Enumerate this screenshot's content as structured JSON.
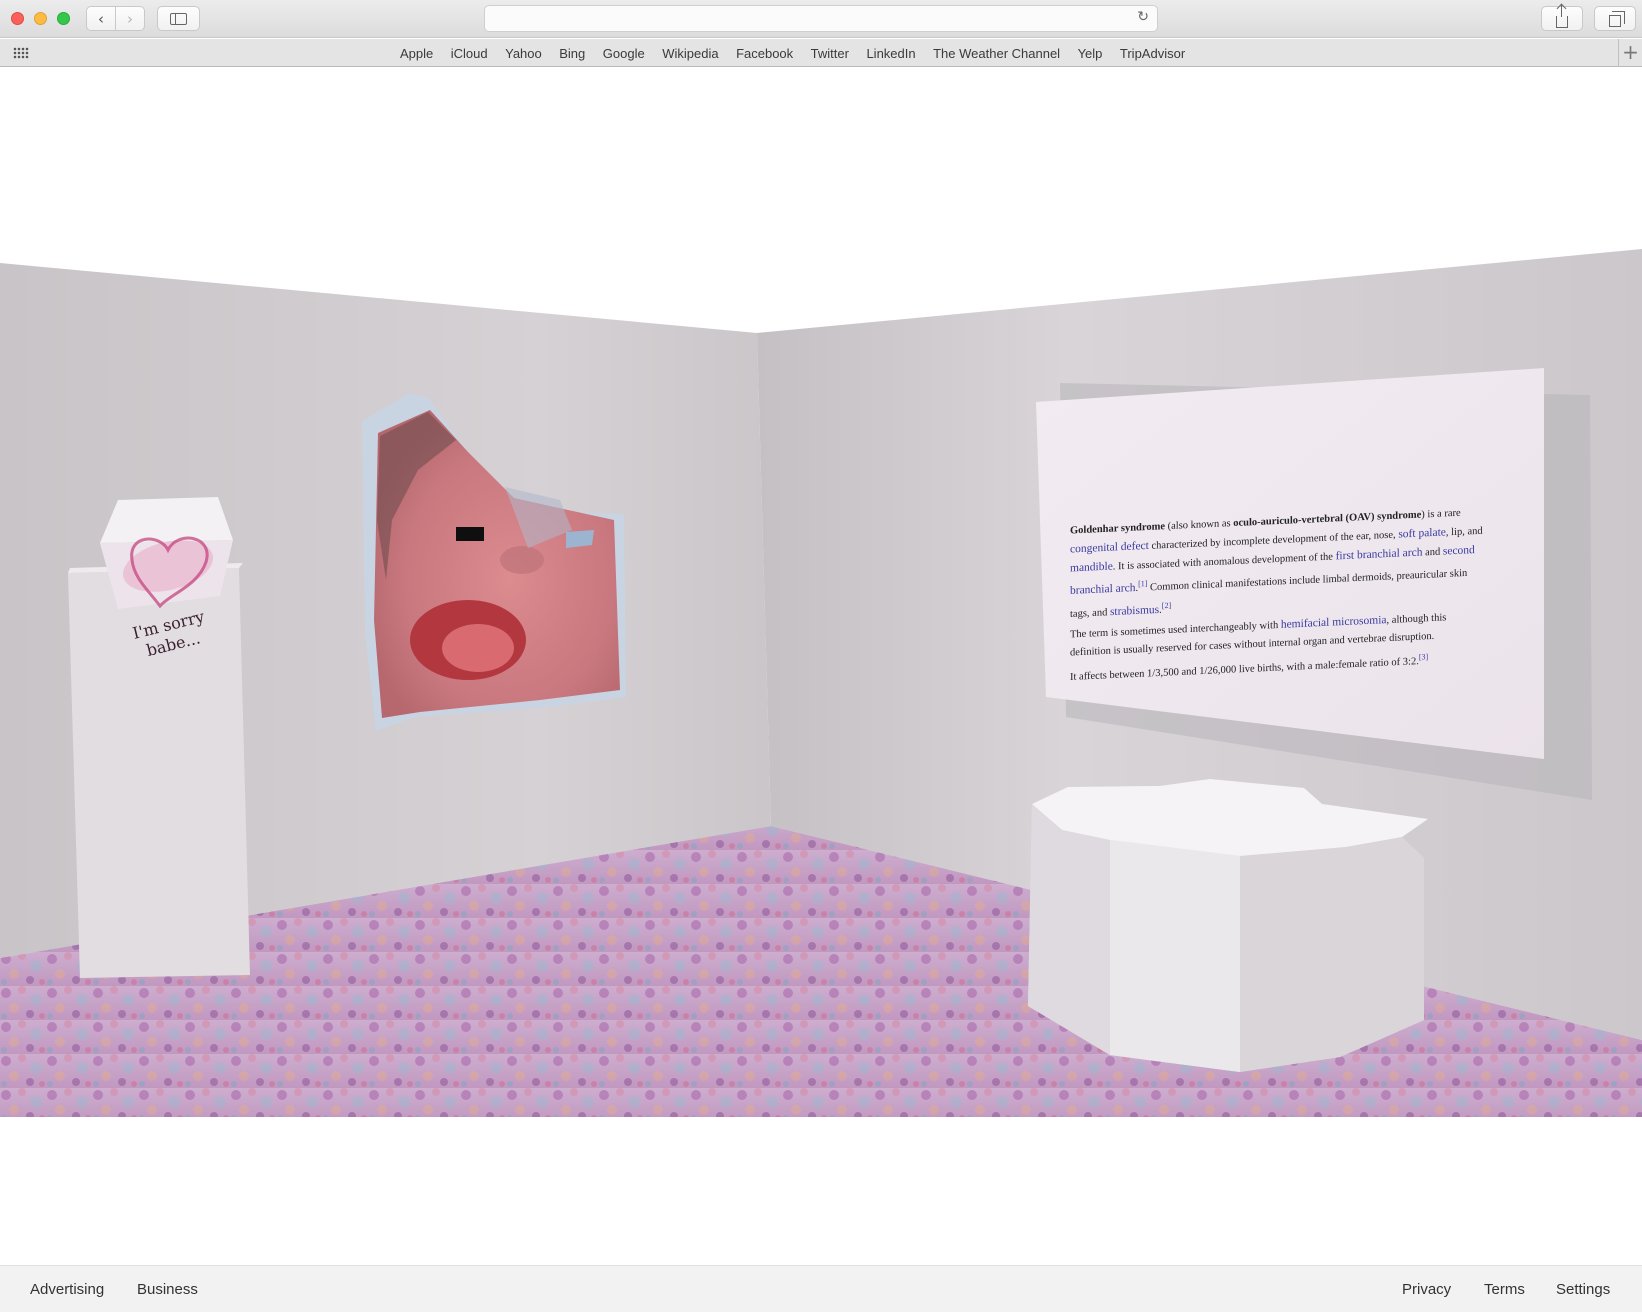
{
  "browser": {
    "url": "",
    "bookmarks": [
      "Apple",
      "iCloud",
      "Yahoo",
      "Bing",
      "Google",
      "Wikipedia",
      "Facebook",
      "Twitter",
      "LinkedIn",
      "The Weather Channel",
      "Yelp",
      "TripAdvisor"
    ]
  },
  "gallery": {
    "box_label": [
      "I'm sorry",
      "babe..."
    ],
    "wall_text": {
      "p1": {
        "term": "Goldenhar syndrome",
        "t1": " (also known as ",
        "alt": "oculo-auriculo-vertebral (OAV) syndrome",
        "t2": ") is a rare ",
        "l1": "congenital defect",
        "t3": " characterized by incomplete development of the ear, nose, ",
        "l2": "soft palate",
        "t4": ", lip, and ",
        "l3": "mandible",
        "t5": ". It is associated with anomalous development of the ",
        "l4": "first branchial arch",
        "t6": " and ",
        "l5": "second branchial arch",
        "t7": ".",
        "r1": "[1]",
        "t8": " Common clinical manifestations include limbal dermoids, preauricular skin tags, and ",
        "l6": "strabismus",
        "t9": ".",
        "r2": "[2]"
      },
      "p2": {
        "t1": "The term is sometimes used interchangeably with ",
        "l1": "hemifacial microsomia",
        "t2": ", although this definition is usually reserved for cases without internal organ and vertebrae disruption."
      },
      "p3": {
        "t1": "It affects between 1/3,500 and 1/26,000 live births, with a male:female ratio of 3:2.",
        "r1": "[3]"
      }
    }
  },
  "footer": {
    "left": [
      "Advertising",
      "Business"
    ],
    "right": [
      "Privacy",
      "Terms",
      "Settings"
    ]
  }
}
